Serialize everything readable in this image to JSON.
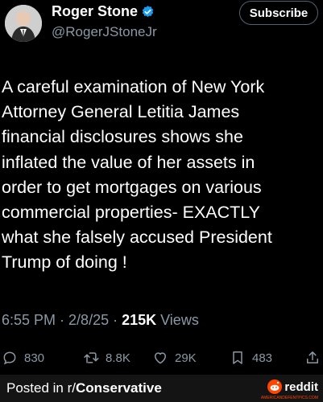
{
  "author": {
    "display_name": "Roger Stone",
    "handle": "@RogerJStoneJr",
    "verified_icon": "verified-badge-icon"
  },
  "subscribe_label": "Subscribe",
  "tweet": {
    "text": "A careful examination of New York\nAttorney General Letitia James\nfinancial disclosures shows she\ninflated the value of her assets in\norder to get mortgages on various\ncommercial properties- EXACTLY\nwhat she falsely accused President\nTrump of doing !"
  },
  "meta": {
    "time": "6:55 PM",
    "sep1": "·",
    "date": "2/8/25",
    "sep2": "·",
    "views_count": "215K",
    "views_label": "Views"
  },
  "actions": {
    "replies": "830",
    "reposts": "8.8K",
    "likes": "29K",
    "bookmarks": "483"
  },
  "footer": {
    "posted_prefix": "Posted in r/",
    "subreddit": "Conservative",
    "reddit_word": "reddit",
    "reddit_small": "AMERICANDEFENTPICS.COM"
  },
  "colors": {
    "background": "#000000",
    "text": "#ffffff",
    "muted": "#8b98a5",
    "verified": "#1d9bf0",
    "reddit": "#ff4500"
  }
}
